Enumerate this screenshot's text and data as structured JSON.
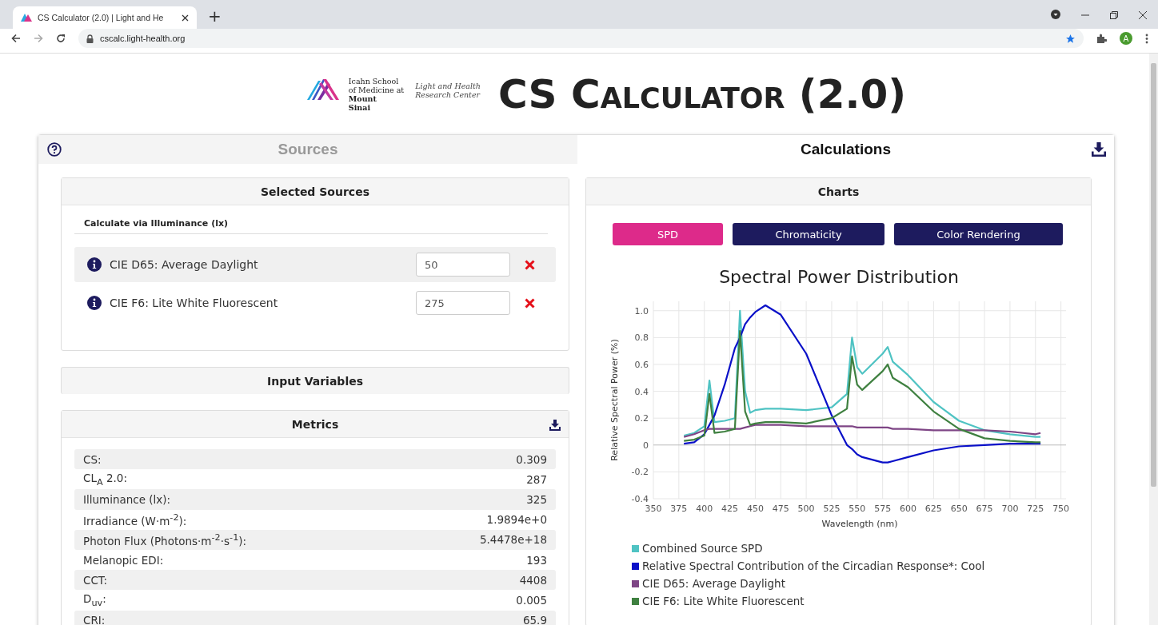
{
  "browser": {
    "tab_title": "CS Calculator (2.0) | Light and He",
    "new_tab": "+",
    "url": "cscalc.light-health.org",
    "avatar": "A"
  },
  "header": {
    "org_name": [
      "Icahn School",
      "of Medicine at"
    ],
    "org_name_bold": [
      "Mount",
      "Sinai"
    ],
    "center_name": [
      "Light and Health",
      "Research Center"
    ],
    "title": "CS Calculator (2.0)"
  },
  "tabs": [
    {
      "label": "Sources",
      "selected": false
    },
    {
      "label": "Calculations",
      "selected": true
    }
  ],
  "selected_sources": {
    "title": "Selected Sources",
    "subtitle": "Calculate via Illuminance (lx)",
    "items": [
      {
        "name": "CIE D65: Average Daylight",
        "value": "50",
        "highlighted": true
      },
      {
        "name": "CIE F6: Lite White Fluorescent",
        "value": "275",
        "highlighted": false
      }
    ]
  },
  "input_variables": {
    "title": "Input Variables"
  },
  "metrics": {
    "title": "Metrics",
    "rows": [
      {
        "label": "CS:",
        "value": "0.309"
      },
      {
        "label": "CL$_{A}$ 2.0:",
        "value": "287"
      },
      {
        "label": "Illuminance (lx):",
        "value": "325"
      },
      {
        "label": "Irradiance (W·m$^{-2}$):",
        "value": "1.9894e+0"
      },
      {
        "label": "Photon Flux (Photons·m$^{-2}$·s$^{-1}$):",
        "value": "5.4478e+18"
      },
      {
        "label": "Melanopic EDI:",
        "value": "193"
      },
      {
        "label": "CCT:",
        "value": "4408"
      },
      {
        "label": "D$_{uv}$:",
        "value": "0.005"
      },
      {
        "label": "CRI:",
        "value": "65.9"
      }
    ]
  },
  "charts": {
    "title": "Charts",
    "buttons": [
      {
        "label": "SPD",
        "selected": true
      },
      {
        "label": "Chromaticity",
        "selected": false
      },
      {
        "label": "Color Rendering",
        "selected": false
      }
    ],
    "chart_data": {
      "type": "line",
      "title": "Spectral Power Distribution",
      "xlabel": "Wavelength (nm)",
      "ylabel": "Relative Spectral Power (%)",
      "x": [
        380,
        390,
        400,
        405,
        410,
        420,
        430,
        435,
        440,
        445,
        450,
        460,
        475,
        500,
        525,
        540,
        545,
        550,
        555,
        575,
        580,
        585,
        600,
        625,
        650,
        675,
        700,
        725,
        730
      ],
      "series": [
        {
          "name": "Combined Source SPD",
          "color": "#4fc3c3",
          "values": [
            0.07,
            0.09,
            0.14,
            0.48,
            0.17,
            0.18,
            0.2,
            1.0,
            0.4,
            0.24,
            0.26,
            0.27,
            0.27,
            0.26,
            0.28,
            0.38,
            0.8,
            0.58,
            0.53,
            0.68,
            0.73,
            0.62,
            0.52,
            0.32,
            0.18,
            0.11,
            0.08,
            0.06,
            0.06
          ]
        },
        {
          "name": "Relative Spectral Contribution of the Circadian Response*: Cool",
          "color": "#0a10c8",
          "values": [
            0.01,
            0.02,
            0.08,
            0.15,
            0.22,
            0.45,
            0.72,
            0.8,
            0.9,
            0.95,
            0.99,
            1.04,
            0.97,
            0.68,
            0.22,
            0.0,
            -0.03,
            -0.07,
            -0.09,
            -0.13,
            -0.13,
            -0.12,
            -0.09,
            -0.04,
            -0.01,
            0.0,
            0.01,
            0.01,
            0.01
          ]
        },
        {
          "name": "CIE D65: Average Daylight",
          "color": "#7e4585",
          "values": [
            0.06,
            0.08,
            0.11,
            0.12,
            0.12,
            0.12,
            0.12,
            0.12,
            0.13,
            0.14,
            0.15,
            0.15,
            0.15,
            0.14,
            0.14,
            0.14,
            0.14,
            0.13,
            0.13,
            0.13,
            0.13,
            0.12,
            0.12,
            0.11,
            0.11,
            0.11,
            0.1,
            0.08,
            0.09
          ]
        },
        {
          "name": "CIE F6: Lite White Fluorescent",
          "color": "#3f8040",
          "values": [
            0.03,
            0.04,
            0.07,
            0.38,
            0.09,
            0.1,
            0.12,
            0.85,
            0.25,
            0.15,
            0.16,
            0.17,
            0.17,
            0.16,
            0.2,
            0.27,
            0.66,
            0.45,
            0.41,
            0.55,
            0.6,
            0.5,
            0.43,
            0.25,
            0.12,
            0.05,
            0.03,
            0.02,
            0.02
          ]
        }
      ],
      "grid": true,
      "xlim": [
        350,
        755
      ],
      "ylim": [
        -0.4,
        1.07
      ],
      "xticks": [
        350,
        375,
        400,
        425,
        450,
        475,
        500,
        525,
        550,
        575,
        600,
        625,
        650,
        675,
        700,
        725,
        750
      ],
      "yticks": [
        {
          "value": -0.4,
          "label": "-0.4"
        },
        {
          "value": -0.2,
          "label": "-0.2"
        },
        {
          "value": 0,
          "label": "0"
        },
        {
          "value": 0.2,
          "label": "0.2"
        },
        {
          "value": 0.4,
          "label": "0.4"
        },
        {
          "value": 0.6,
          "label": "0.6"
        },
        {
          "value": 0.8,
          "label": "0.8"
        },
        {
          "value": 1,
          "label": "1.0"
        }
      ]
    }
  }
}
